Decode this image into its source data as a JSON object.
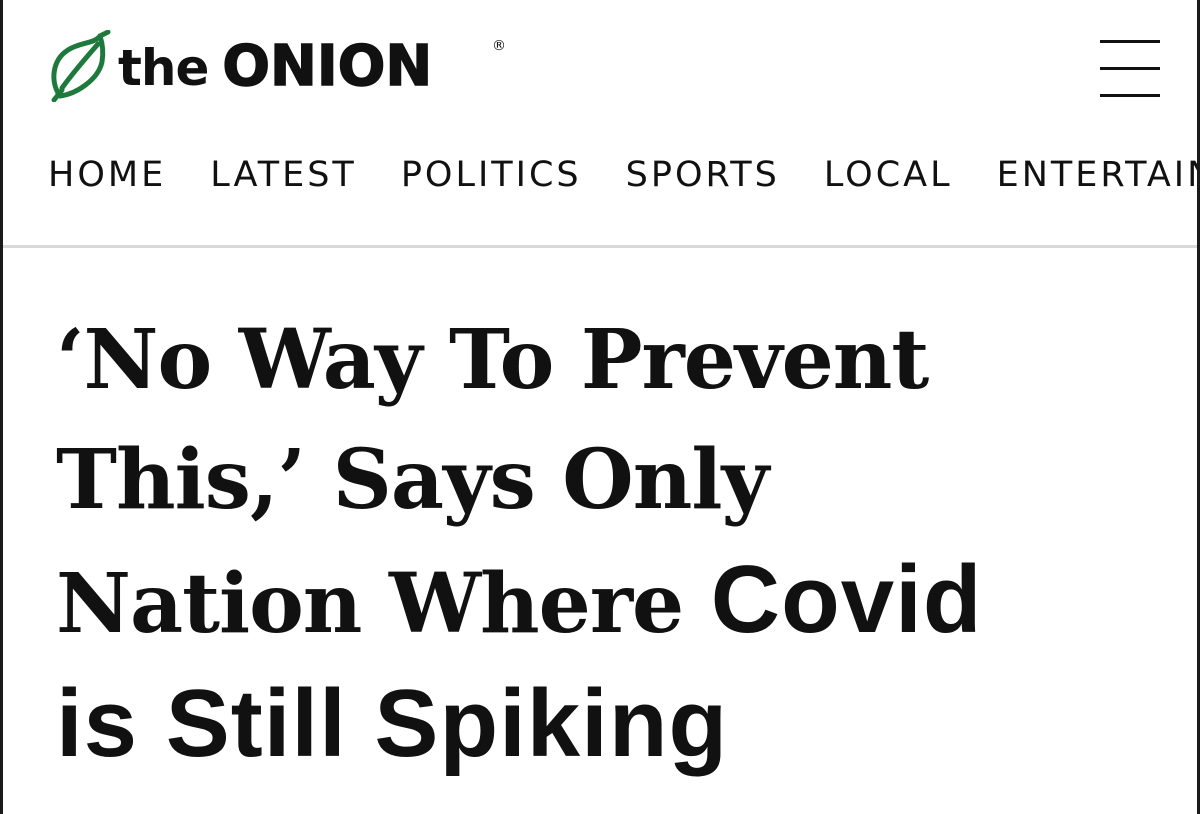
{
  "header": {
    "logo_text": "the ONION",
    "logo_the": "the",
    "logo_onion": "ONION",
    "registered_mark": "®",
    "logo_icon": "onion-icon",
    "logo_color": "#1e7a3c",
    "menu_icon": "hamburger-menu-icon"
  },
  "nav": {
    "items": [
      {
        "label": "HOME"
      },
      {
        "label": "LATEST"
      },
      {
        "label": "POLITICS"
      },
      {
        "label": "SPORTS"
      },
      {
        "label": "LOCAL"
      },
      {
        "label": "ENTERTAINMENT"
      }
    ]
  },
  "article": {
    "headline_line1": "‘No Way To Prevent",
    "headline_line2": "This,’ Says Only",
    "headline_line3_serif": "Nation Where ",
    "headline_line3_sans": "Covid",
    "headline_line4": "is Still Spiking"
  }
}
